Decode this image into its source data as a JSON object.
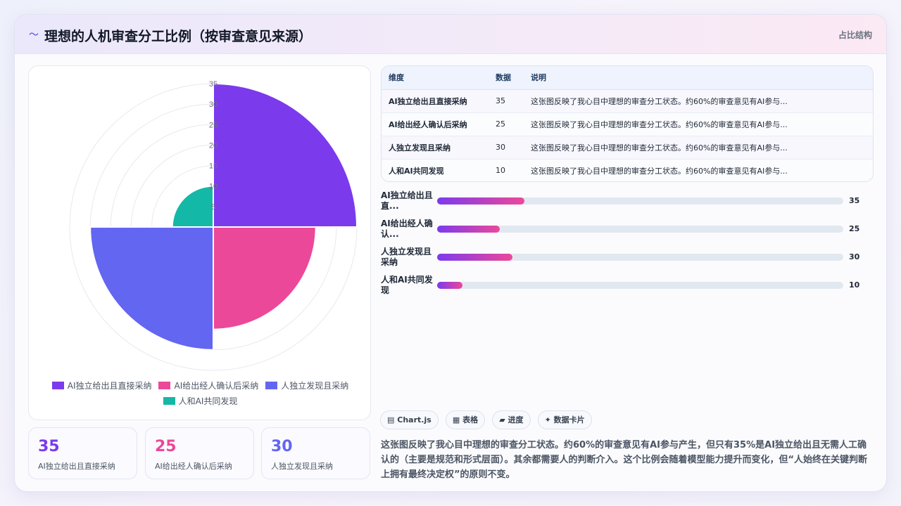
{
  "header": {
    "title_icon": "〜",
    "title": "理想的人机审查分工比例（按审查意见来源）",
    "tag": "占比结构"
  },
  "chart_data": {
    "type": "polarArea",
    "categories": [
      "AI独立给出且直接采纳",
      "AI给出经人确认后采纳",
      "人独立发现且采纳",
      "人和AI共同发现"
    ],
    "values": [
      35,
      25,
      30,
      10
    ],
    "colors": [
      "#7c3aed",
      "#ec4899",
      "#6366f1",
      "#14b8a6"
    ],
    "r_ticks": [
      "5",
      "10",
      "15",
      "20",
      "25",
      "30",
      "35"
    ],
    "rlim": [
      0,
      35
    ]
  },
  "legend": [
    {
      "label": "AI独立给出且直接采纳",
      "color": "#7c3aed"
    },
    {
      "label": "AI给出经人确认后采纳",
      "color": "#ec4899"
    },
    {
      "label": "人独立发现且采纳",
      "color": "#6366f1"
    },
    {
      "label": "人和AI共同发现",
      "color": "#14b8a6"
    }
  ],
  "stats": [
    {
      "value": "35",
      "label": "AI独立给出且直接采纳",
      "color": "#7c3aed"
    },
    {
      "value": "25",
      "label": "AI给出经人确认后采纳",
      "color": "#ec4899"
    },
    {
      "value": "30",
      "label": "人独立发现且采纳",
      "color": "#6366f1"
    }
  ],
  "table": {
    "headers": [
      "维度",
      "数据",
      "说明"
    ],
    "rows": [
      [
        "AI独立给出且直接采纳",
        "35",
        "这张图反映了我心目中理想的审查分工状态。约60%的审查意见有AI参与..."
      ],
      [
        "AI给出经人确认后采纳",
        "25",
        "这张图反映了我心目中理想的审查分工状态。约60%的审查意见有AI参与..."
      ],
      [
        "人独立发现且采纳",
        "30",
        "这张图反映了我心目中理想的审查分工状态。约60%的审查意见有AI参与..."
      ],
      [
        "人和AI共同发现",
        "10",
        "这张图反映了我心目中理想的审查分工状态。约60%的审查意见有AI参与..."
      ]
    ]
  },
  "progress": [
    {
      "label": "AI独立给出且直...",
      "value": "35",
      "fraction": 0.215
    },
    {
      "label": "AI给出经人确认...",
      "value": "25",
      "fraction": 0.155
    },
    {
      "label": "人独立发现且采纳",
      "value": "30",
      "fraction": 0.185
    },
    {
      "label": "人和AI共同发现",
      "value": "10",
      "fraction": 0.062
    }
  ],
  "chips": [
    {
      "icon": "▤",
      "label": "Chart.js"
    },
    {
      "icon": "▦",
      "label": "表格"
    },
    {
      "icon": "▰",
      "label": "进度"
    },
    {
      "icon": "✦",
      "label": "数据卡片"
    }
  ],
  "description": "这张图反映了我心目中理想的审查分工状态。约60%的审查意见有AI参与产生，但只有35%是AI独立给出且无需人工确认的（主要是规范和形式层面）。其余都需要人的判断介入。这个比例会随着模型能力提升而变化，但“人始终在关键判断上拥有最终决定权”的原则不变。"
}
